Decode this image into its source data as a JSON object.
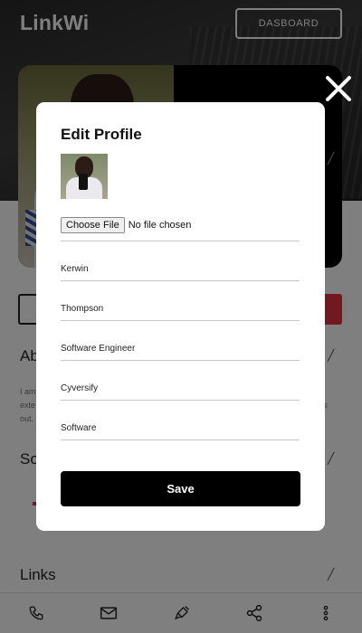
{
  "header": {
    "logo": "LinkWi",
    "dashboard_button": "DASBOARD"
  },
  "background_sections": {
    "about_heading": "Ab",
    "about_text_line1": "I am",
    "about_text_line2": "exte",
    "about_text_line2_end": "s",
    "about_text_line3": "out.",
    "social_heading": "So",
    "links_heading": "Links"
  },
  "bottom_nav": {
    "icons": [
      "phone-icon",
      "mail-icon",
      "brush-icon",
      "share-icon",
      "more-icon"
    ]
  },
  "modal": {
    "title": "Edit Profile",
    "file_button": "Choose File",
    "file_status": "No file chosen",
    "fields": {
      "first_name": "Kerwin",
      "last_name": "Thompson",
      "job_title": "Software Engineer",
      "company": "Cyversify",
      "industry": "Software"
    },
    "save_label": "Save"
  },
  "colors": {
    "accent_red": "#e0323f",
    "primary": "#000000",
    "overlay": "rgba(0,0,0,0.5)"
  }
}
